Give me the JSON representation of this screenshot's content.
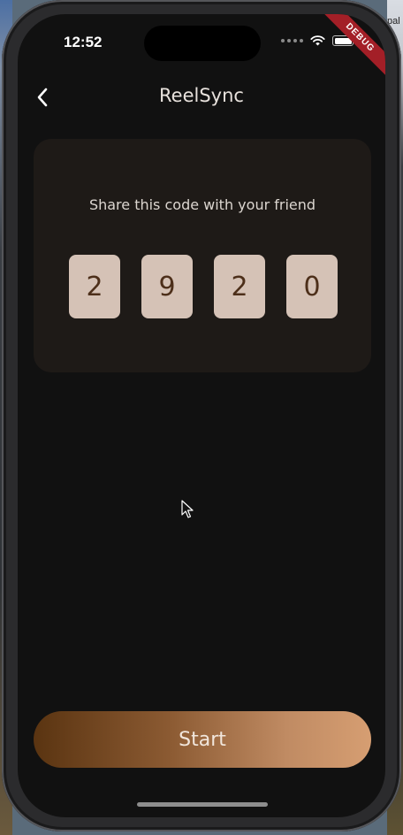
{
  "status_bar": {
    "time": "12:52",
    "signal_icon": "cellular-dots-icon",
    "wifi_icon": "wifi-icon",
    "battery_icon": "battery-icon"
  },
  "debug_banner": "DEBUG",
  "backdrop": {
    "right_edge_text": "pal"
  },
  "header": {
    "back_icon": "chevron-left-icon",
    "title": "ReelSync"
  },
  "code_card": {
    "caption": "Share this code with your friend",
    "digits": [
      "2",
      "9",
      "2",
      "0"
    ]
  },
  "start_button": {
    "label": "Start"
  },
  "colors": {
    "background": "#111111",
    "card": "#1e1a17",
    "digit_tile": "#d5c2b6",
    "digit_text": "#4d2f1a",
    "button_gradient_start": "#5a3411",
    "button_gradient_end": "#d69e72",
    "debug_banner": "#a31f27"
  }
}
